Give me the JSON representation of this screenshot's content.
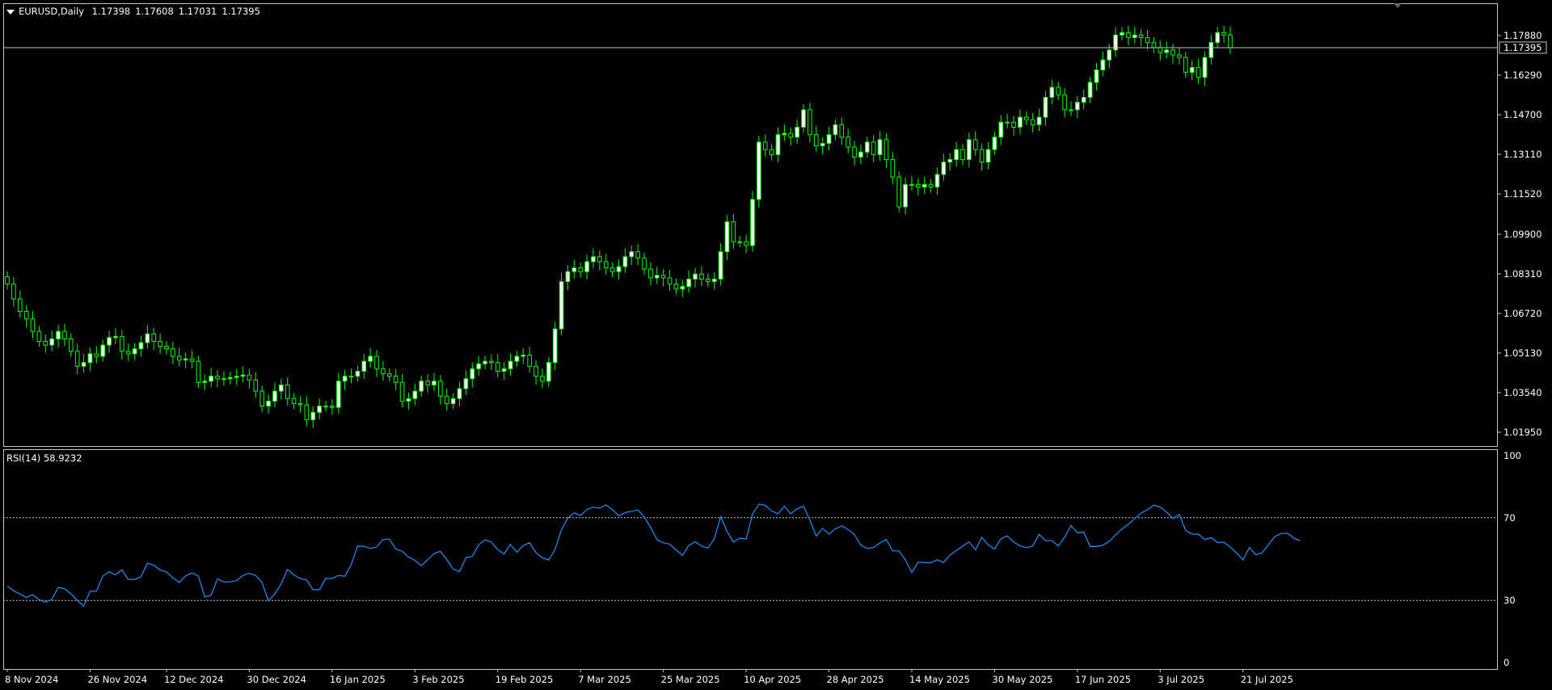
{
  "header": {
    "symbol_timeframe": "EURUSD,Daily",
    "open": "1.17398",
    "high": "1.17608",
    "low": "1.17031",
    "close": "1.17395"
  },
  "rsi_header": {
    "label": "RSI(14)",
    "value": "58.9232"
  },
  "colors": {
    "background": "#000000",
    "frame": "#c8c8c8",
    "candle": "#00ff00",
    "bull_fill": "#ffffff",
    "bear_fill": "#000000",
    "rsi_line": "#1e90ff",
    "level_line": "#c8c8c8",
    "price_line": "#c0c0c0"
  },
  "chart_data": [
    {
      "type": "candlestick",
      "title": "EURUSD,Daily",
      "ylim": [
        1.0115,
        1.1938
      ],
      "y_ticks": [
        "1.17880",
        "1.16290",
        "1.14700",
        "1.13110",
        "1.11520",
        "1.09900",
        "1.08310",
        "1.06720",
        "1.05130",
        "1.03540",
        "1.01950"
      ],
      "y_tick_values": [
        1.1788,
        1.1629,
        1.147,
        1.1311,
        1.1152,
        1.099,
        1.0831,
        1.0672,
        1.0513,
        1.0354,
        1.0195
      ],
      "last_price": 1.17395,
      "last_price_label": "1.17395",
      "x_ticks": [
        "8 Nov 2024",
        "26 Nov 2024",
        "12 Dec 2024",
        "30 Dec 2024",
        "16 Jan 2025",
        "3 Feb 2025",
        "19 Feb 2025",
        "7 Mar 2025",
        "25 Mar 2025",
        "10 Apr 2025",
        "28 Apr 2025",
        "14 May 2025",
        "30 May 2025",
        "17 Jun 2025",
        "3 Jul 2025",
        "21 Jul 2025"
      ],
      "x_tick_bar_index": [
        0,
        13,
        25,
        38,
        51,
        64,
        77,
        90,
        103,
        116,
        129,
        142,
        155,
        168,
        181,
        194
      ],
      "close": [
        1.079,
        1.073,
        1.068,
        1.065,
        1.06,
        1.056,
        1.0545,
        1.057,
        1.06,
        1.057,
        1.052,
        1.046,
        1.0475,
        1.051,
        1.05,
        1.0545,
        1.0575,
        1.058,
        1.052,
        1.051,
        1.053,
        1.0555,
        1.059,
        1.056,
        1.054,
        1.053,
        1.05,
        1.0485,
        1.049,
        1.048,
        1.0395,
        1.04,
        1.042,
        1.041,
        1.041,
        1.0415,
        1.042,
        1.0425,
        1.0405,
        1.036,
        1.03,
        1.032,
        1.036,
        1.0385,
        1.033,
        1.031,
        1.0305,
        1.0245,
        1.0275,
        1.03,
        1.03,
        1.0295,
        1.04,
        1.042,
        1.042,
        1.044,
        1.048,
        1.05,
        1.045,
        1.043,
        1.042,
        1.0395,
        1.032,
        1.033,
        1.036,
        1.04,
        1.0385,
        1.04,
        1.034,
        1.031,
        1.033,
        1.037,
        1.041,
        1.045,
        1.047,
        1.048,
        1.0475,
        1.044,
        1.045,
        1.048,
        1.05,
        1.0505,
        1.046,
        1.042,
        1.04,
        1.0475,
        1.061,
        1.08,
        1.084,
        1.0855,
        1.084,
        1.088,
        1.09,
        1.088,
        1.0855,
        1.084,
        1.086,
        1.09,
        1.092,
        1.0895,
        1.085,
        1.0815,
        1.0825,
        1.0815,
        1.079,
        1.077,
        1.078,
        1.081,
        1.083,
        1.081,
        1.08,
        1.081,
        1.092,
        1.104,
        1.096,
        1.096,
        1.0945,
        1.113,
        1.136,
        1.133,
        1.131,
        1.139,
        1.1395,
        1.138,
        1.142,
        1.149,
        1.139,
        1.1345,
        1.1355,
        1.139,
        1.143,
        1.138,
        1.134,
        1.13,
        1.132,
        1.136,
        1.131,
        1.137,
        1.129,
        1.122,
        1.11,
        1.119,
        1.119,
        1.118,
        1.119,
        1.118,
        1.123,
        1.128,
        1.129,
        1.133,
        1.129,
        1.137,
        1.133,
        1.128,
        1.133,
        1.138,
        1.144,
        1.144,
        1.142,
        1.146,
        1.145,
        1.143,
        1.146,
        1.154,
        1.158,
        1.155,
        1.149,
        1.149,
        1.152,
        1.154,
        1.16,
        1.165,
        1.169,
        1.173,
        1.179,
        1.18,
        1.178,
        1.179,
        1.178,
        1.176,
        1.174,
        1.172,
        1.173,
        1.171,
        1.17,
        1.164,
        1.166,
        1.162,
        1.17,
        1.176,
        1.18,
        1.179,
        1.17395
      ]
    },
    {
      "type": "line",
      "title": "RSI(14) 58.9232",
      "ylim": [
        0,
        100
      ],
      "y_ticks": [
        "100",
        "70",
        "30",
        "0"
      ],
      "y_tick_values": [
        100,
        70,
        30,
        0
      ],
      "levels": [
        70,
        30
      ],
      "series": [
        {
          "name": "RSI(14)",
          "values": [
            37,
            34.6,
            33.1,
            31.5,
            32.8,
            30.4,
            29.2,
            30.5,
            36.3,
            35.7,
            33.2,
            30,
            27.3,
            34.5,
            34.5,
            41.8,
            43.9,
            42.4,
            44.8,
            40.2,
            40.2,
            41.5,
            48.1,
            47,
            44.8,
            43.8,
            40.9,
            38.7,
            41.9,
            43.3,
            41.8,
            31.7,
            32.5,
            40.5,
            39,
            39,
            39.6,
            42.1,
            43.1,
            42.1,
            38.7,
            29.8,
            33.2,
            38.1,
            45,
            42.4,
            40.6,
            39.9,
            35.2,
            35.2,
            40.7,
            40.6,
            42.1,
            41.7,
            47.4,
            56.3,
            56.2,
            55.1,
            55.9,
            59.5,
            59.7,
            54.8,
            53.8,
            51,
            49.4,
            46.8,
            49.7,
            52.7,
            53.7,
            49.8,
            45.2,
            43.9,
            50.8,
            51.3,
            56.8,
            59.4,
            58.2,
            54.6,
            52.5,
            57.1,
            53.3,
            56.6,
            57.9,
            53.2,
            50.6,
            49.6,
            54.7,
            64.2,
            69.8,
            72.3,
            71.1,
            74,
            75.1,
            74.6,
            76.2,
            74,
            70.9,
            72.5,
            73.1,
            73.8,
            70.4,
            65.3,
            59.4,
            57.9,
            57.2,
            54.5,
            51.7,
            56.6,
            58.4,
            56.3,
            55.4,
            59.9,
            70.5,
            63.4,
            58.3,
            60.2,
            59.7,
            71.8,
            76.6,
            76,
            73.3,
            71.9,
            75.6,
            71.9,
            74.3,
            75.6,
            68.9,
            61.1,
            64.8,
            62.1,
            64.6,
            66,
            64.3,
            61.9,
            56.8,
            55.1,
            55.6,
            57.8,
            59.5,
            54,
            54,
            49.6,
            43.5,
            48.5,
            48.3,
            48.3,
            49.7,
            48.4,
            52,
            54.2,
            56.3,
            58.4,
            54.5,
            60.5,
            56.9,
            54.8,
            59.9,
            61.2,
            58.3,
            56.4,
            55.5,
            56.4,
            62,
            58.9,
            58.9,
            56.4,
            60.6,
            66.2,
            62.7,
            63.1,
            56.1,
            56.1,
            56.7,
            58.6,
            61.7,
            64.6,
            66.8,
            69.6,
            72.2,
            73.9,
            76.1,
            75.2,
            72.7,
            69.7,
            71.6,
            63.8,
            62.1,
            62.1,
            59.5,
            60.4,
            58,
            58.2,
            55.8,
            53,
            49.6,
            55.6,
            52.2,
            53,
            56.9,
            60.9,
            62.4,
            62.5,
            60.1,
            58.9232
          ]
        }
      ]
    }
  ]
}
